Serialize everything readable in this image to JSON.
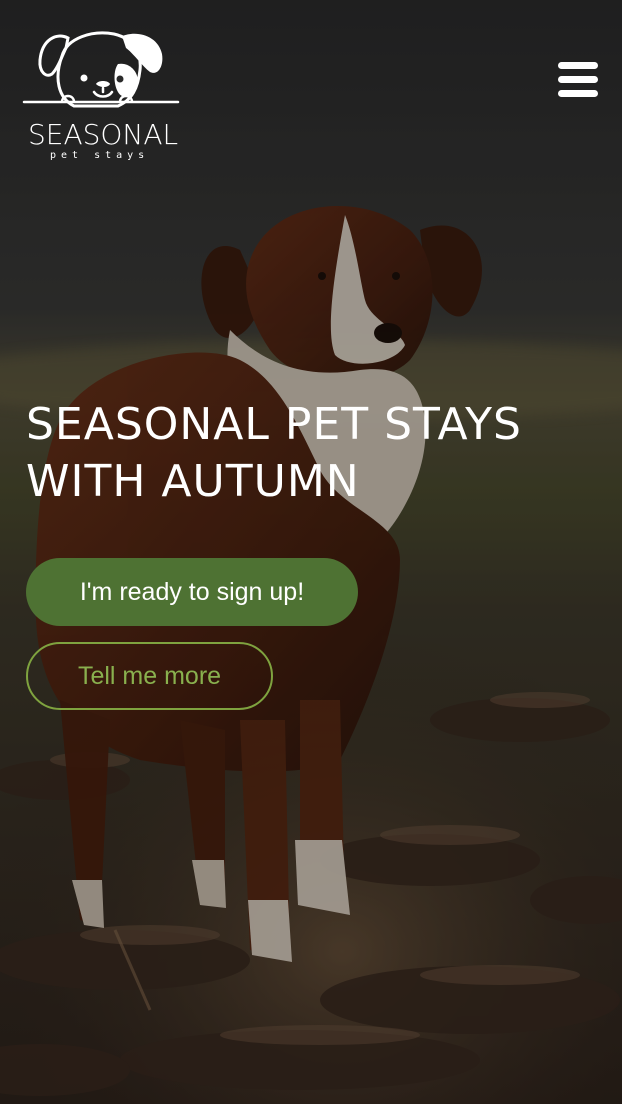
{
  "brand": {
    "name": "SEASONAL",
    "tagline": "pet stays",
    "logo_icon": "dog-face-icon"
  },
  "header": {
    "menu_icon": "hamburger-menu-icon"
  },
  "hero": {
    "headline": "SEASONAL PET STAYS WITH AUTUMN",
    "background": "dog-in-field-photo",
    "primary_button_label": "I'm ready to sign up!",
    "secondary_button_label": "Tell me more"
  },
  "colors": {
    "primary_button_bg": "#4e7233",
    "secondary_button_border": "#7fa33f",
    "secondary_button_text": "#89b04e",
    "text_on_hero": "#ffffff"
  }
}
